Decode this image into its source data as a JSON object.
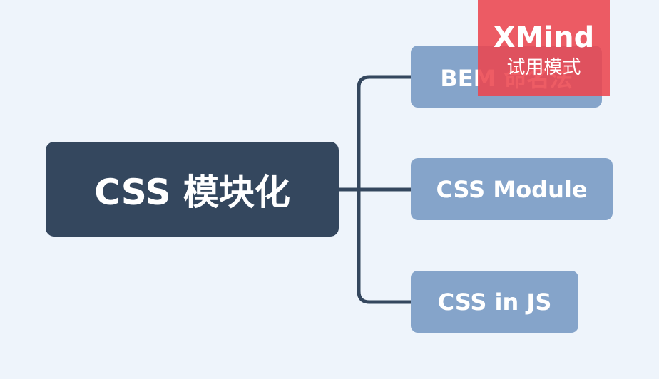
{
  "mindmap": {
    "root": {
      "label": "CSS 模块化"
    },
    "branches": [
      {
        "label": "BEM 命名法"
      },
      {
        "label": "CSS Module"
      },
      {
        "label": "CSS in JS"
      }
    ]
  },
  "watermark": {
    "brand": "XMind",
    "mode": "试用模式"
  },
  "colors": {
    "background": "#eef4fb",
    "root_fill": "#34475e",
    "branch_fill": "#85a4ca",
    "connector": "#34475e",
    "watermark_fill": "#ec464e"
  }
}
